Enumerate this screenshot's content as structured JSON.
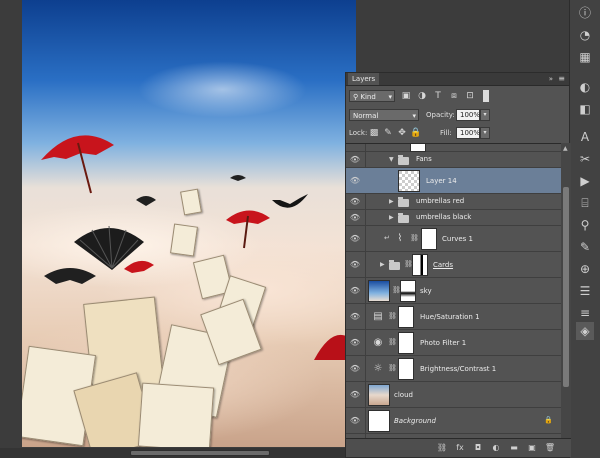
{
  "panel": {
    "tab_label": "Layers",
    "collapse_glyph": "»",
    "menu_glyph": "≡"
  },
  "filter": {
    "label": "Kind"
  },
  "blend": {
    "mode": "Normal",
    "opacity_label": "Opacity:",
    "opacity_value": "100%"
  },
  "lock": {
    "label": "Lock:",
    "fill_label": "Fill:",
    "fill_value": "100%"
  },
  "layers": [
    {
      "name": "Fans"
    },
    {
      "name": "Layer 14"
    },
    {
      "name": "umbrellas red"
    },
    {
      "name": "umbrellas black"
    },
    {
      "name": "Curves 1"
    },
    {
      "name": "Cards"
    },
    {
      "name": "sky"
    },
    {
      "name": "Hue/Saturation 1"
    },
    {
      "name": "Photo Filter 1"
    },
    {
      "name": "Brightness/Contrast 1"
    },
    {
      "name": "cloud"
    },
    {
      "name": "Background"
    }
  ],
  "icons": {
    "eye": "eye-icon",
    "folder": "folder-icon",
    "chain": "link-icon",
    "lock": "lock-icon",
    "curves": "curves-icon",
    "hue": "hue-saturation-icon",
    "photo_filter": "photo-filter-icon",
    "brightness": "brightness-contrast-icon"
  },
  "colors": {
    "selection": "#6b7f98",
    "panel_bg": "#535353",
    "umbrella_red": "#c8141c"
  }
}
